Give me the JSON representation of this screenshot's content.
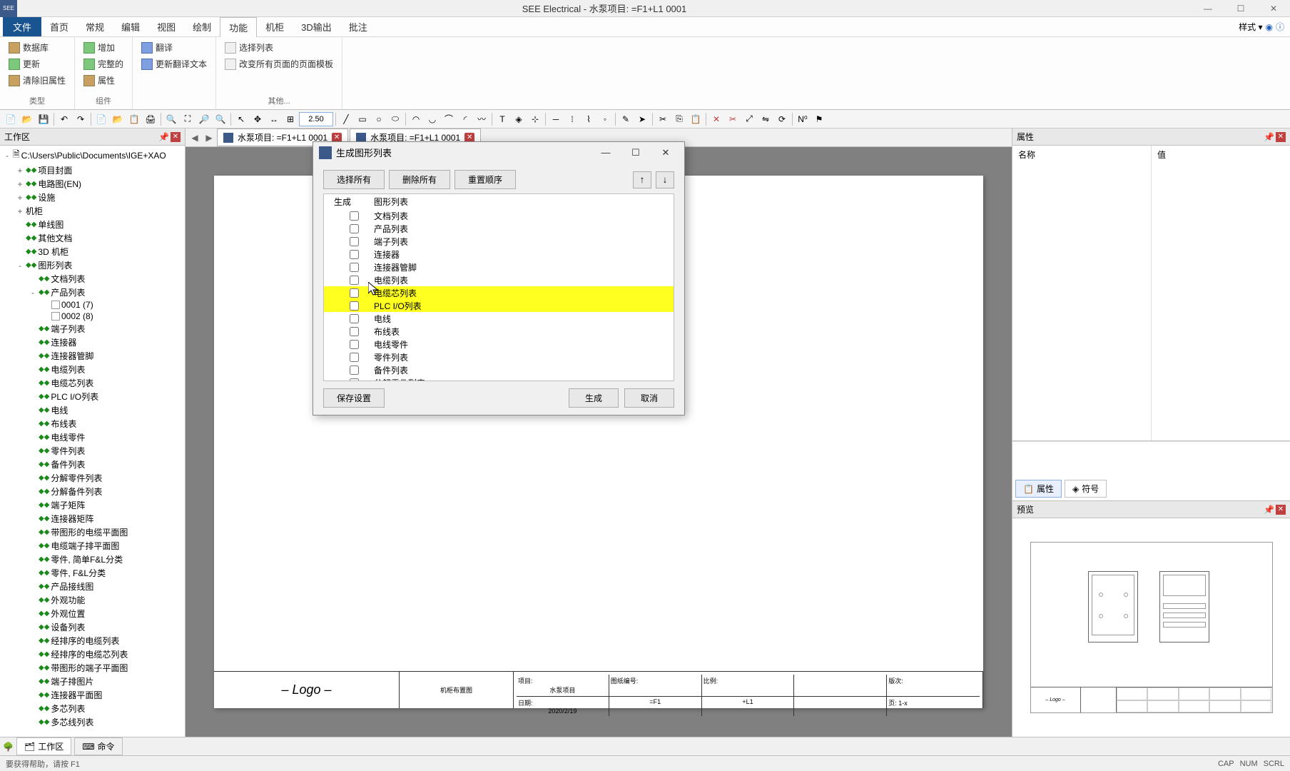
{
  "window": {
    "title": "SEE Electrical - 水泵项目: =F1+L1 0001",
    "minimize": "—",
    "maximize": "☐",
    "close": "✕"
  },
  "menu": {
    "file": "文件",
    "items": [
      "首页",
      "常规",
      "编辑",
      "视图",
      "绘制",
      "功能",
      "机柜",
      "3D输出",
      "批注"
    ],
    "active_index": 5,
    "style_label": "样式"
  },
  "ribbon": {
    "groups": [
      {
        "label": "类型",
        "items": [
          "数据库",
          "更新",
          "清除旧属性"
        ]
      },
      {
        "label": "组件",
        "items": [
          "增加",
          "完整的",
          "属性"
        ]
      },
      {
        "label": "",
        "items": [
          "翻译",
          "更新翻译文本"
        ]
      },
      {
        "label": "其他...",
        "items": [
          "选择列表",
          "改变所有页面的页面模板"
        ]
      }
    ]
  },
  "toolbar": {
    "zoom_value": "2.50"
  },
  "left_panel": {
    "title": "工作区",
    "root": "C:\\Users\\Public\\Documents\\IGE+XAO",
    "tree": [
      {
        "label": "项目封面",
        "indent": 1,
        "exp": "+",
        "dia": true
      },
      {
        "label": "电路图(EN)",
        "indent": 1,
        "exp": "+",
        "dia": true
      },
      {
        "label": "设施",
        "indent": 1,
        "exp": "+",
        "dia": true
      },
      {
        "label": "机柜",
        "indent": 1,
        "exp": "+"
      },
      {
        "label": "单线图",
        "indent": 1,
        "dia": true
      },
      {
        "label": "其他文档",
        "indent": 1,
        "dia": true
      },
      {
        "label": "3D 机柜",
        "indent": 1,
        "dia": true
      },
      {
        "label": "图形列表",
        "indent": 1,
        "exp": "-",
        "dia": true
      },
      {
        "label": "文档列表",
        "indent": 2,
        "dia": true
      },
      {
        "label": "产品列表",
        "indent": 2,
        "exp": "-",
        "dia": true
      },
      {
        "label": "0001   (7)",
        "indent": 3,
        "pg": true
      },
      {
        "label": "0002   (8)",
        "indent": 3,
        "pg": true
      },
      {
        "label": "端子列表",
        "indent": 2,
        "dia": true
      },
      {
        "label": "连接器",
        "indent": 2,
        "dia": true
      },
      {
        "label": "连接器管脚",
        "indent": 2,
        "dia": true
      },
      {
        "label": "电缆列表",
        "indent": 2,
        "dia": true
      },
      {
        "label": "电缆芯列表",
        "indent": 2,
        "dia": true
      },
      {
        "label": "PLC I/O列表",
        "indent": 2,
        "dia": true
      },
      {
        "label": "电线",
        "indent": 2,
        "dia": true
      },
      {
        "label": "布线表",
        "indent": 2,
        "dia": true
      },
      {
        "label": "电线零件",
        "indent": 2,
        "dia": true
      },
      {
        "label": "零件列表",
        "indent": 2,
        "dia": true
      },
      {
        "label": "备件列表",
        "indent": 2,
        "dia": true
      },
      {
        "label": "分解零件列表",
        "indent": 2,
        "dia": true
      },
      {
        "label": "分解备件列表",
        "indent": 2,
        "dia": true
      },
      {
        "label": "端子矩阵",
        "indent": 2,
        "dia": true
      },
      {
        "label": "连接器矩阵",
        "indent": 2,
        "dia": true
      },
      {
        "label": "带图形的电缆平面图",
        "indent": 2,
        "dia": true
      },
      {
        "label": "电缆端子排平面图",
        "indent": 2,
        "dia": true
      },
      {
        "label": "零件, 简单F&L分类",
        "indent": 2,
        "dia": true
      },
      {
        "label": "零件, F&L分类",
        "indent": 2,
        "dia": true
      },
      {
        "label": "产品接线图",
        "indent": 2,
        "dia": true
      },
      {
        "label": "外观功能",
        "indent": 2,
        "dia": true
      },
      {
        "label": "外观位置",
        "indent": 2,
        "dia": true
      },
      {
        "label": "设备列表",
        "indent": 2,
        "dia": true
      },
      {
        "label": "经排序的电缆列表",
        "indent": 2,
        "dia": true
      },
      {
        "label": "经排序的电缆芯列表",
        "indent": 2,
        "dia": true
      },
      {
        "label": "带图形的端子平面图",
        "indent": 2,
        "dia": true
      },
      {
        "label": "端子排图片",
        "indent": 2,
        "dia": true
      },
      {
        "label": "连接器平面图",
        "indent": 2,
        "dia": true
      },
      {
        "label": "多芯列表",
        "indent": 2,
        "dia": true
      },
      {
        "label": "多芯线列表",
        "indent": 2,
        "dia": true
      }
    ]
  },
  "tabs": [
    {
      "label": "水泵项目: =F1+L1 0001",
      "active": false
    },
    {
      "label": "水泵项目: =F1+L1 0001",
      "active": true
    }
  ],
  "right_panel": {
    "prop_title": "属性",
    "col_name": "名称",
    "col_value": "值",
    "tab_prop": "属性",
    "tab_sym": "符号",
    "preview_title": "预览"
  },
  "page_tb": {
    "logo": "– Logo –",
    "label1": "机柜布置图",
    "f1": "项目:",
    "f1v": "水泵项目",
    "f2": "图纸编号:",
    "f3": "比例:",
    "f4": "版次:",
    "f5": "日期:",
    "f5v": "2020/2/19",
    "f6": "=F1",
    "f7": "+L1",
    "f8": "页:",
    "f8v": "1-x"
  },
  "bottom_tabs": {
    "work": "工作区",
    "cmd": "命令"
  },
  "status": {
    "left": "要获得帮助，请按 F1",
    "right_items": [
      "CAP",
      "NUM",
      "SCRL"
    ]
  },
  "dialog": {
    "title": "生成图形列表",
    "select_all": "选择所有",
    "delete_all": "删除所有",
    "reset_order": "重置顺序",
    "hdr_gen": "生成",
    "hdr_list": "图形列表",
    "items": [
      {
        "label": "文档列表",
        "checked": false
      },
      {
        "label": "产品列表",
        "checked": false
      },
      {
        "label": "端子列表",
        "checked": false
      },
      {
        "label": "连接器",
        "checked": false
      },
      {
        "label": "连接器管脚",
        "checked": false
      },
      {
        "label": "电缆列表",
        "checked": false
      },
      {
        "label": "电缆芯列表",
        "checked": false,
        "hl": true
      },
      {
        "label": "PLC I/O列表",
        "checked": false,
        "hl": true
      },
      {
        "label": "电线",
        "checked": false
      },
      {
        "label": "布线表",
        "checked": false
      },
      {
        "label": "电线零件",
        "checked": false
      },
      {
        "label": "零件列表",
        "checked": false
      },
      {
        "label": "备件列表",
        "checked": false
      },
      {
        "label": "分解零件列表",
        "checked": false
      },
      {
        "label": "分解备件列表",
        "checked": false
      },
      {
        "label": "端子矩阵",
        "checked": false
      }
    ],
    "save_settings": "保存设置",
    "generate": "生成",
    "cancel": "取消"
  }
}
